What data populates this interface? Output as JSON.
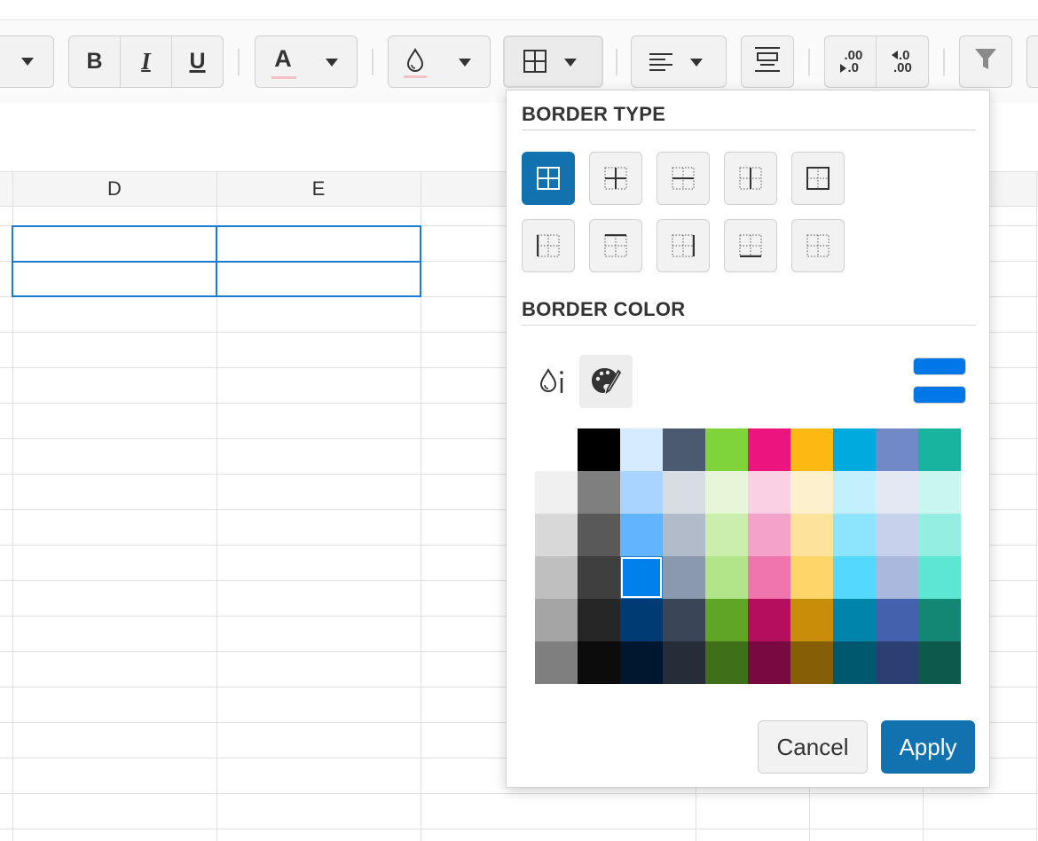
{
  "toolbar": {
    "bold_label": "B",
    "italic_label": "I",
    "underline_label": "U",
    "font_color_label": "A",
    "decimal_increase_label": ".00",
    "decimal_decrease_label": ".00",
    "icons": [
      "chevron-down-icon",
      "font-color-icon",
      "fill-color-icon",
      "borders-icon",
      "align-left-icon",
      "wrap-text-icon",
      "decimal-increase-icon",
      "decimal-decrease-icon",
      "filter-icon"
    ]
  },
  "grid": {
    "columns": [
      "D",
      "E"
    ],
    "selection_border_color": "#1a7bd0"
  },
  "popover": {
    "border_type_title": "BORDER TYPE",
    "border_color_title": "BORDER COLOR",
    "border_types": [
      "all-borders",
      "inner-borders",
      "horizontal-borders",
      "vertical-borders",
      "outer-borders",
      "left-border",
      "top-border",
      "right-border",
      "bottom-border",
      "no-border"
    ],
    "selected_border_type": "all-borders",
    "color_modes": [
      "fill-dropper-icon",
      "palette-icon"
    ],
    "selected_color_mode": "palette-icon",
    "current_colors": [
      "#0077e6",
      "#0077e6"
    ],
    "palette": [
      [
        "#ffffff",
        "#000000",
        "#d6ebff",
        "#4b5a70",
        "#7fd33b",
        "#ec147f",
        "#fdb813",
        "#00a9de",
        "#7189c6",
        "#19b49f"
      ],
      [
        "#f0f0f0",
        "#7f7f7f",
        "#a8d4ff",
        "#d8dde4",
        "#e7f6d8",
        "#f9d0e4",
        "#fdf0cc",
        "#c4f0fe",
        "#e3e8f3",
        "#c9f6ef"
      ],
      [
        "#d8d8d8",
        "#595959",
        "#63b4ff",
        "#b1bbc9",
        "#cbedae",
        "#f4a2c9",
        "#fde39a",
        "#8ce5fd",
        "#c7d1eb",
        "#94eee1"
      ],
      [
        "#bfbfbf",
        "#3f3f3f",
        "#0080ea",
        "#8b99ae",
        "#b2e58a",
        "#f075ae",
        "#fdd569",
        "#54d9fd",
        "#aab8de",
        "#5de6d2"
      ],
      [
        "#a5a5a5",
        "#262626",
        "#003b73",
        "#3a4558",
        "#60a526",
        "#b40e5e",
        "#c98e09",
        "#0084ab",
        "#4361ad",
        "#138774"
      ],
      [
        "#7f7f7f",
        "#0c0c0c",
        "#00182f",
        "#262d39",
        "#406f1a",
        "#780941",
        "#855e05",
        "#00586f",
        "#2c3f73",
        "#0d5a4d"
      ]
    ],
    "selected_cell": [
      3,
      2
    ],
    "cancel_label": "Cancel",
    "apply_label": "Apply"
  }
}
